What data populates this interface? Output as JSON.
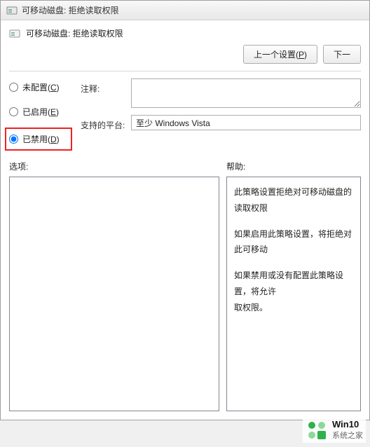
{
  "window": {
    "title": "可移动磁盘: 拒绝读取权限"
  },
  "header": {
    "title": "可移动磁盘: 拒绝读取权限"
  },
  "nav": {
    "prev": "上一个设置(P)",
    "next": "下一"
  },
  "radios": {
    "not_configured": "未配置(C)",
    "enabled": "已启用(E)",
    "disabled": "已禁用(D)"
  },
  "fields": {
    "comment_label": "注释:",
    "comment_value": "",
    "platform_label": "支持的平台:",
    "platform_value": "至少 Windows Vista"
  },
  "lower": {
    "options_label": "选项:",
    "help_label": "帮助:"
  },
  "help": {
    "p1": "此策略设置拒绝对可移动磁盘的读取权限",
    "p2": "如果启用此策略设置，将拒绝对此可移动",
    "p3": "如果禁用或没有配置此策略设置，将允许",
    "p4": "取权限。"
  },
  "watermark": {
    "brand": "Win10",
    "site": "系统之家"
  }
}
